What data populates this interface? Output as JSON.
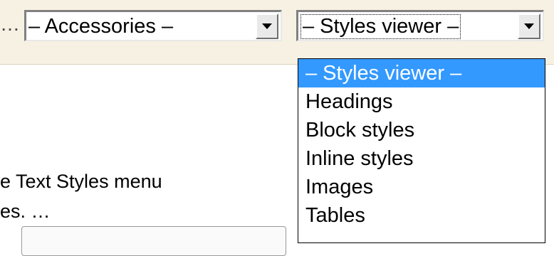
{
  "toolbar": {
    "ellipsis": "…",
    "accessories_select": {
      "value": "– Accessories –"
    },
    "styles_select": {
      "value": "– Styles viewer –"
    }
  },
  "dropdown": {
    "options": [
      "– Styles viewer –",
      "Headings",
      "Block styles",
      "Inline styles",
      "Images",
      "Tables"
    ],
    "selected_index": 0
  },
  "background_text": {
    "line1": "e Text Styles menu",
    "line2": "es. …"
  },
  "colors": {
    "toolbar_bg": "#f7f1e3",
    "selected_option_bg": "#3399ff"
  },
  "icons": [
    "chevron-down-icon"
  ]
}
